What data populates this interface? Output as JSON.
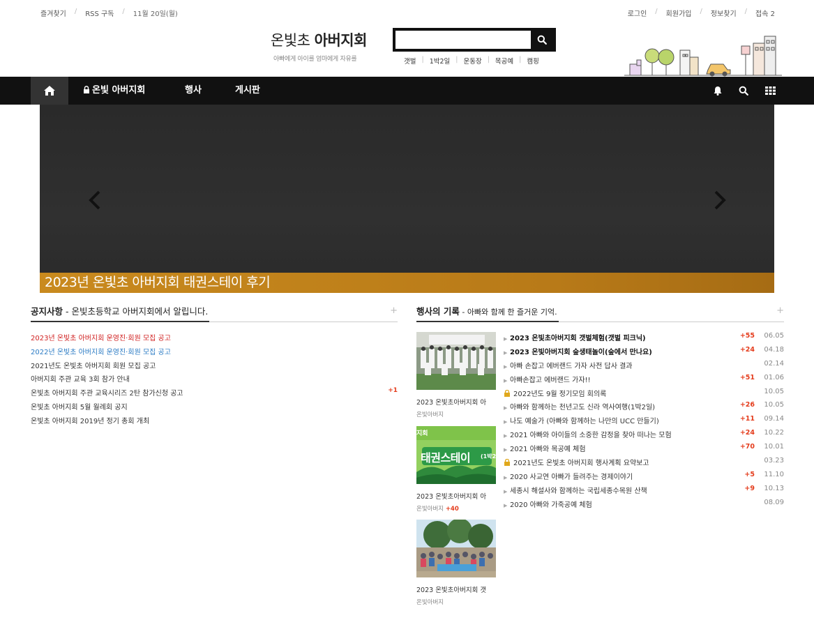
{
  "topbar": {
    "left": [
      "즐겨찾기",
      "RSS 구독",
      "11월 20일(월)"
    ],
    "right": [
      "로그인",
      "회원가입",
      "정보찾기",
      "접속 2"
    ]
  },
  "header": {
    "logo_light": "온빛초",
    "logo_bold": "아버지회",
    "slogan": "아빠에게 아이를 엄마에게 자유를",
    "search_placeholder": "",
    "quicklinks": [
      "갯벌",
      "1박2일",
      "운동장",
      "목공예",
      "캠핑"
    ]
  },
  "nav": {
    "items": [
      "온빛 아버지회",
      "행사",
      "게시판"
    ]
  },
  "slider": {
    "caption": "2023년 온빛초 아버지회 태권스테이 후기"
  },
  "notice": {
    "title": "공지사항",
    "subtitle": " - 온빛초등학교 아버지회에서 알립니다.",
    "plus": "+",
    "rows": [
      {
        "text": "2023년 온빛초 아버지회 운영진·회원 모집 공고",
        "color": "red",
        "count": ""
      },
      {
        "text": "2022년 온빛초 아버지회 운영진·회원 모집 공고",
        "color": "blue",
        "count": ""
      },
      {
        "text": "2021년도 온빛초 아버지회 회원 모집 공고",
        "color": "",
        "count": ""
      },
      {
        "text": "아버지회 주관 교육 3회 참가 안내",
        "color": "",
        "count": ""
      },
      {
        "text": "온빛초 아버지회 주관 교육시리즈 2탄 참가신청 공고",
        "color": "",
        "count": "+1"
      },
      {
        "text": "온빛초 아버지회 5월 월례회 공지",
        "color": "",
        "count": ""
      },
      {
        "text": "온빛초 아버지회 2019년 정기 총회 개최",
        "color": "",
        "count": ""
      }
    ]
  },
  "events": {
    "title": "행사의 기록",
    "subtitle": " - 아빠와 함께 한 즐거운 기억.",
    "plus": "+",
    "thumbs": [
      {
        "title": "2023 온빛초아버지회 아",
        "author": "온빛아버지",
        "count": ""
      },
      {
        "title": "2023 온빛초아버지회 아",
        "author": "온빛아버지",
        "count": "+40"
      },
      {
        "title": "2023 온빛초아버지회 갯",
        "author": "온빛아버지",
        "count": ""
      }
    ],
    "thumb_banner_left": "지회",
    "thumb_banner": "태권스테이",
    "thumb_banner_tag": "(1박2",
    "rows": [
      {
        "text": "2023 온빛초아버지회 갯벌체험(갯벌 피크닉)",
        "bold": true,
        "lock": false,
        "count": "+55",
        "date": "06.05"
      },
      {
        "text": "2023 온빛아버지회 숲생태놀이(숲에서 만나요)",
        "bold": true,
        "lock": false,
        "count": "+24",
        "date": "04.18"
      },
      {
        "text": "아빠 손잡고 에버랜드 가자 사전 답사 결과",
        "bold": false,
        "lock": false,
        "count": "",
        "date": "02.14"
      },
      {
        "text": "아빠손잡고 에버랜드 가자!!",
        "bold": false,
        "lock": false,
        "count": "+51",
        "date": "01.06"
      },
      {
        "text": "2022년도 9월 정기모임 회의록",
        "bold": false,
        "lock": true,
        "count": "",
        "date": "10.05"
      },
      {
        "text": "아빠와 함께하는 천년고도 신라 역사여행(1박2일)",
        "bold": false,
        "lock": false,
        "count": "+26",
        "date": "10.05"
      },
      {
        "text": "나도 예술가 (아빠와 함께하는 나만의 UCC 만들기)",
        "bold": false,
        "lock": false,
        "count": "+11",
        "date": "09.14"
      },
      {
        "text": "2021 아빠와 아이들의 소중한 감정을 찾아 떠나는 모험",
        "bold": false,
        "lock": false,
        "count": "+24",
        "date": "10.22"
      },
      {
        "text": "2021 아빠와 목공예 체험",
        "bold": false,
        "lock": false,
        "count": "+70",
        "date": "10.01"
      },
      {
        "text": "2021년도 온빛초 아버지회 행사계획 요약보고",
        "bold": false,
        "lock": true,
        "count": "",
        "date": "03.23"
      },
      {
        "text": "2020 사교연 아빠가 들려주는 경제이야기",
        "bold": false,
        "lock": false,
        "count": "+5",
        "date": "11.10"
      },
      {
        "text": "세종시 해설사와 함께하는 국립세종수목원 산책",
        "bold": false,
        "lock": false,
        "count": "+9",
        "date": "10.13"
      },
      {
        "text": "2020 아빠와 가죽공예 체험",
        "bold": false,
        "lock": false,
        "count": "",
        "date": "08.09"
      }
    ]
  }
}
